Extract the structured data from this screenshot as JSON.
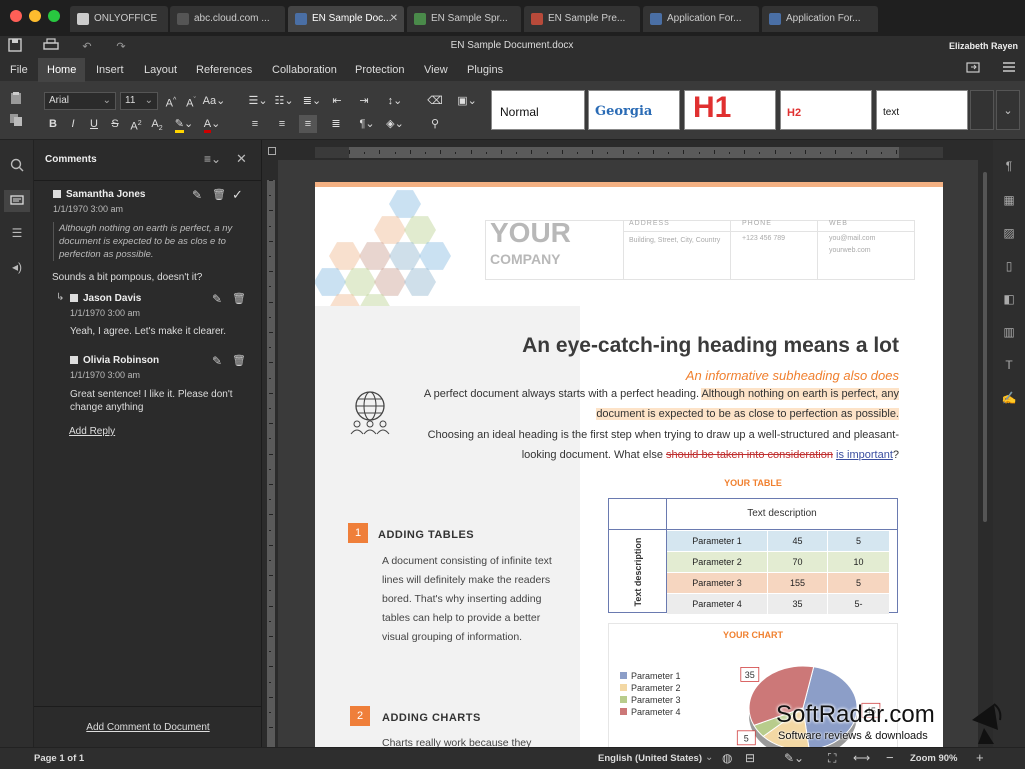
{
  "window": {
    "title": "EN Sample Document.docx",
    "user": "Elizabeth Rayen",
    "tabs": [
      {
        "label": "ONLYOFFICE",
        "color": "#cccccc"
      },
      {
        "label": "abc.cloud.com ...",
        "color": "#555555"
      },
      {
        "label": "EN Sample Doc...",
        "color": "#4a6fa5"
      },
      {
        "label": "EN Sample Spr...",
        "color": "#4a8a4a"
      },
      {
        "label": "EN Sample Pre...",
        "color": "#b84a3a"
      },
      {
        "label": "Application For...",
        "color": "#4a6fa5"
      },
      {
        "label": "Application For...",
        "color": "#4a6fa5"
      }
    ]
  },
  "menu": {
    "items": [
      "File",
      "Home",
      "Insert",
      "Layout",
      "References",
      "Collaboration",
      "Protection",
      "View",
      "Plugins"
    ],
    "active": "Home"
  },
  "toolbar": {
    "font_name": "Arial",
    "font_size": "11",
    "styles": [
      "Normal",
      "Georgia",
      "H1",
      "H2",
      "text"
    ]
  },
  "comments": {
    "title": "Comments",
    "thread": {
      "author": "Samantha Jones",
      "date": "1/1/1970 3:00 am",
      "quote": "Although nothing on earth is perfect, a ny document is expected to be as clos e to perfection as possible.",
      "text": "Sounds a bit pompous, doesn't it?",
      "replies": [
        {
          "author": "Jason Davis",
          "date": "1/1/1970 3:00 am",
          "text": "Yeah, I agree. Let's make it clearer."
        },
        {
          "author": "Olivia Robinson",
          "date": "1/1/1970 3:00 am",
          "text": "Great sentence! I like it. Please don't change anything"
        }
      ],
      "add_reply": "Add Reply"
    },
    "add_comment": "Add Comment to Document"
  },
  "document": {
    "logo_line1": "YOUR",
    "logo_line2": "COMPANY",
    "contact": {
      "address_label": "ADDRESS",
      "address_value": "Building, Street, City, Country",
      "phone_label": "PHONE",
      "phone_value": "+123 456 789",
      "web_label": "WEB",
      "web_value1": "you@mail.com",
      "web_value2": "yourweb.com"
    },
    "heading": "An eye-catch-ing heading means a lot",
    "subheading": "An informative subheading also does",
    "para1": "A perfect document always starts with a perfect heading.",
    "para1_highlight": "Although nothing on earth is perfect, any document is expected to be as close to perfection as possible.",
    "para2": "Choosing an ideal heading is the first step when trying to draw up a well-structured and pleasant-looking document. What else",
    "para2_strike": "should be taken into consideration",
    "para2_underline": "is important",
    "para2_end": "?",
    "section1_num": "1",
    "section1_title": "ADDING TABLES",
    "section1_text": "A document consisting of infinite text lines will definitely make the readers bored. That's why inserting adding tables can help to provide a better visual grouping of information.",
    "section2_num": "2",
    "section2_title": "ADDING CHARTS",
    "section2_text": "Charts really work because they",
    "table_title": "YOUR TABLE",
    "table_header": "Text description",
    "table_side": "Text description",
    "table_rows": [
      {
        "label": "Parameter 1",
        "a": "45",
        "b": "5",
        "color": "#d5e6f0"
      },
      {
        "label": "Parameter 2",
        "a": "70",
        "b": "10",
        "color": "#e3ecd2"
      },
      {
        "label": "Parameter 3",
        "a": "155",
        "b": "5",
        "color": "#f6d6c0"
      },
      {
        "label": "Parameter 4",
        "a": "35",
        "b": "5-",
        "color": "#ececec"
      }
    ],
    "chart_title": "YOUR CHART"
  },
  "chart_data": {
    "type": "pie",
    "title": "YOUR CHART",
    "categories": [
      "Parameter 1",
      "Parameter 2",
      "Parameter 3",
      "Parameter 4"
    ],
    "values": [
      45,
      15,
      5,
      35
    ],
    "colors": [
      "#8c9ec8",
      "#f3d8a4",
      "#b8cc8c",
      "#cc7878"
    ]
  },
  "status": {
    "page": "Page 1 of 1",
    "language": "English (United States)",
    "zoom": "Zoom 90%"
  },
  "watermark": {
    "name": "SoftRadar.com",
    "tagline": "Software reviews & downloads"
  }
}
